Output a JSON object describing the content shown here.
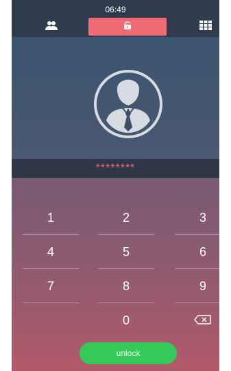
{
  "status": {
    "time": "06:49"
  },
  "tabs": {
    "contacts_icon": "contacts-icon",
    "lock_icon": "unlock-icon",
    "keypad_icon": "keypad-icon",
    "selected": "lock"
  },
  "pin": {
    "masked": "********"
  },
  "keypad": {
    "keys": [
      "1",
      "2",
      "3",
      "4",
      "5",
      "6",
      "7",
      "8",
      "9",
      "0"
    ],
    "backspace_icon": "backspace-icon"
  },
  "actions": {
    "unlock_label": "unlock"
  },
  "colors": {
    "accent_pink": "#f06b76",
    "unlock_green": "#35c95a",
    "topbar": "#2f3b4d"
  }
}
